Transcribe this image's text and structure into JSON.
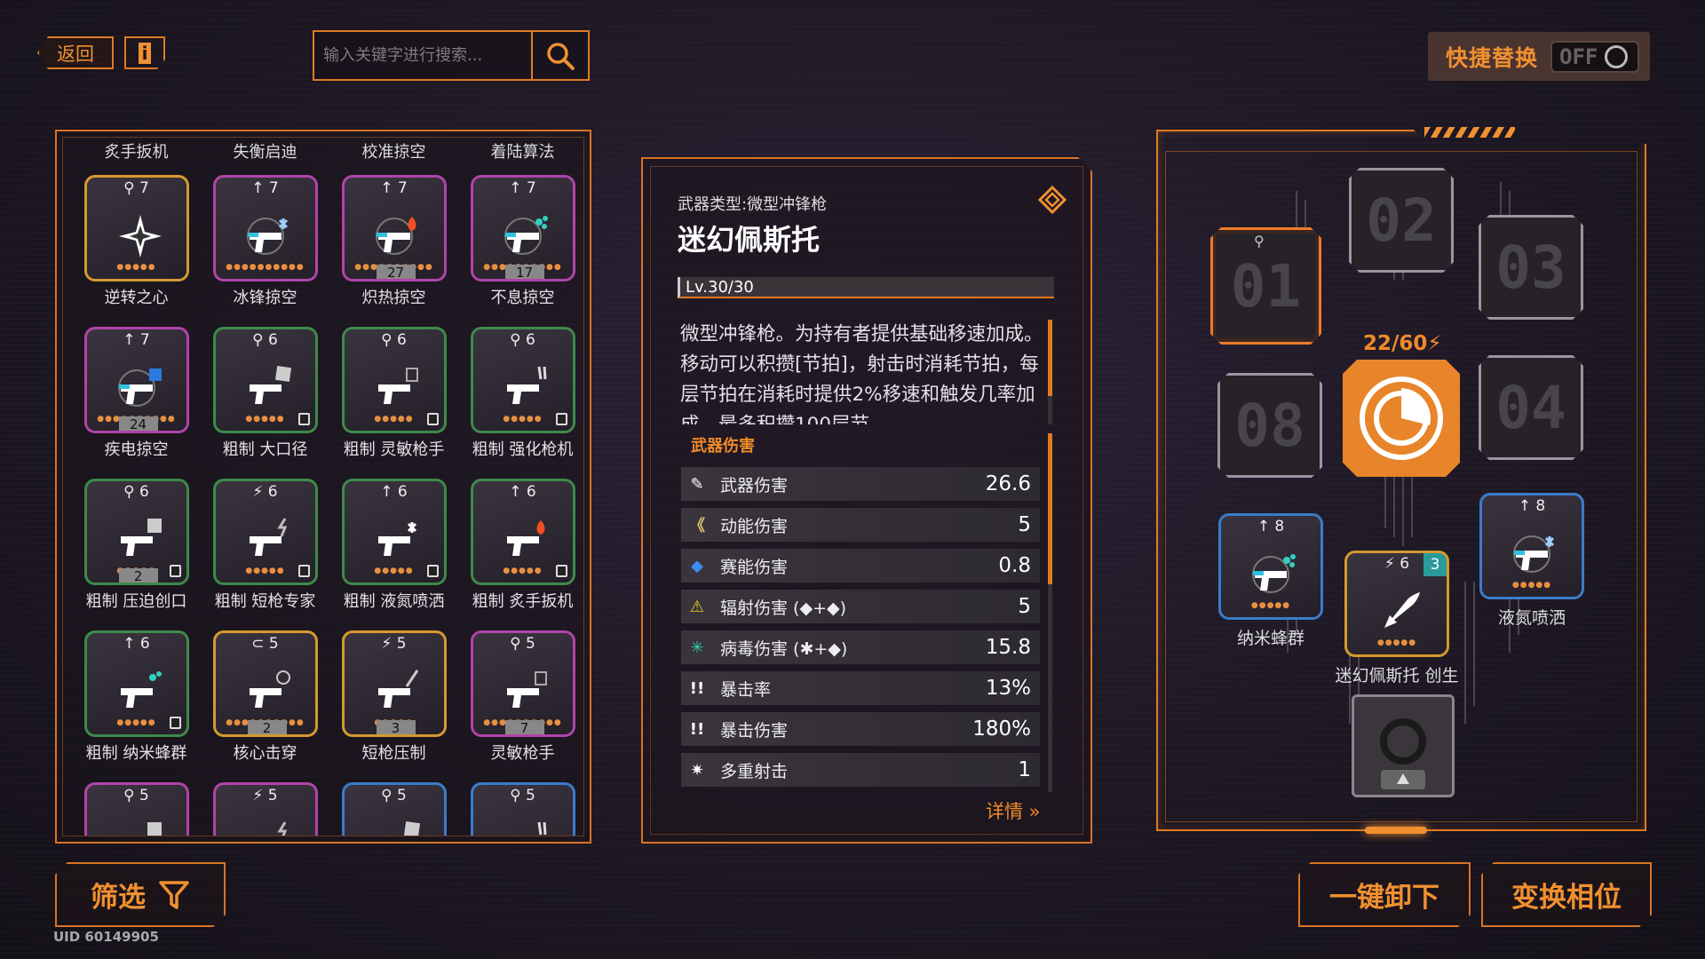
{
  "top": {
    "back_label": "返回",
    "info_label": "i",
    "search_placeholder": "输入关键字进行搜索...",
    "quick_swap_label": "快捷替换",
    "toggle_state": "OFF"
  },
  "inventory": {
    "top_names": [
      "炙手扳机",
      "失衡启迪",
      "校准掠空",
      "着陆算法"
    ],
    "rows": [
      [
        {
          "lv": "⚲ 7",
          "name": "逆转之心",
          "rarity": "gold",
          "icon": "star-core-icon",
          "dots": "●●●●●",
          "num": "",
          "lock": false
        },
        {
          "lv": "↑ 7",
          "name": "冰锋掠空",
          "rarity": "purple",
          "icon": "gun-ice-icon",
          "dots": "●●●●●●●●●●",
          "num": "",
          "lock": false
        },
        {
          "lv": "↑ 7",
          "name": "炽热掠空",
          "rarity": "purple",
          "icon": "gun-fire-icon",
          "dots": "●●●●●●●●●●",
          "num": "27",
          "lock": false
        },
        {
          "lv": "↑ 7",
          "name": "不息掠空",
          "rarity": "purple",
          "icon": "gun-virus-icon",
          "dots": "●●●●●●●●●●",
          "num": "17",
          "lock": false
        }
      ],
      [
        {
          "lv": "↑ 7",
          "name": "疾电掠空",
          "rarity": "purple",
          "icon": "gun-psionic-icon",
          "dots": "●●●●●●●●●●",
          "num": "24",
          "lock": false
        },
        {
          "lv": "⚲ 6",
          "name": "粗制 大口径",
          "rarity": "green",
          "icon": "pistol-damage-icon",
          "dots": "●●●●●",
          "num": "",
          "lock": true
        },
        {
          "lv": "⚲ 6",
          "name": "粗制 灵敏枪手",
          "rarity": "green",
          "icon": "pistol-multishot-icon",
          "dots": "●●●●●",
          "num": "",
          "lock": true
        },
        {
          "lv": "⚲ 6",
          "name": "粗制 强化枪机",
          "rarity": "green",
          "icon": "pistol-crit-icon",
          "dots": "●●●●●",
          "num": "",
          "lock": true
        }
      ],
      [
        {
          "lv": "⚲ 6",
          "name": "粗制 压迫创口",
          "rarity": "green",
          "icon": "pistol-critdmg-icon",
          "dots": "●●●●●",
          "num": "2",
          "lock": true
        },
        {
          "lv": "⚡ 6",
          "name": "粗制 短枪专家",
          "rarity": "green",
          "icon": "pistol-lightning-icon",
          "dots": "●●●●●",
          "num": "",
          "lock": true
        },
        {
          "lv": "↑ 6",
          "name": "粗制 液氮喷洒",
          "rarity": "green",
          "icon": "pistol-ice-icon",
          "dots": "●●●●●",
          "num": "",
          "lock": true
        },
        {
          "lv": "↑ 6",
          "name": "粗制 炙手扳机",
          "rarity": "green",
          "icon": "pistol-fire-icon",
          "dots": "●●●●●",
          "num": "",
          "lock": true
        }
      ],
      [
        {
          "lv": "↑ 6",
          "name": "粗制 纳米蜂群",
          "rarity": "green",
          "icon": "pistol-virus-icon",
          "dots": "●●●●●",
          "num": "",
          "lock": true
        },
        {
          "lv": "⊂ 5",
          "name": "核心击穿",
          "rarity": "gold",
          "icon": "pistol-target-icon",
          "dots": "●●●●●●●●●●",
          "num": "2",
          "lock": false
        },
        {
          "lv": "⚡ 5",
          "name": "短枪压制",
          "rarity": "gold",
          "icon": "pistol-blade-icon",
          "dots": "●●●●●",
          "num": "3",
          "lock": false
        },
        {
          "lv": "⚲ 5",
          "name": "灵敏枪手",
          "rarity": "purple",
          "icon": "pistol-multishot-icon",
          "dots": "●●●●●●●●●●",
          "num": "7",
          "lock": false
        }
      ],
      [
        {
          "lv": "⚲ 5",
          "name": "",
          "rarity": "purple",
          "icon": "pistol-critdmg-icon",
          "dots": "",
          "num": "",
          "lock": false
        },
        {
          "lv": "⚡ 5",
          "name": "",
          "rarity": "purple",
          "icon": "pistol-lightning-icon",
          "dots": "",
          "num": "",
          "lock": false
        },
        {
          "lv": "⚲ 5",
          "name": "",
          "rarity": "blue",
          "icon": "pistol-damage-icon",
          "dots": "",
          "num": "",
          "lock": false
        },
        {
          "lv": "⚲ 5",
          "name": "",
          "rarity": "blue",
          "icon": "pistol-crit-icon",
          "dots": "",
          "num": "",
          "lock": false
        }
      ]
    ]
  },
  "detail": {
    "weapon_type": "武器类型:微型冲锋枪",
    "weapon_name": "迷幻佩斯托",
    "level": "Lv.30/30",
    "description": "微型冲锋枪。为持有者提供基础移速加成。移动可以积攒[节拍]，射击时消耗节拍，每层节拍在消耗时提供2%移速和触发几率加成，最多积攒100层节",
    "section_title": "武器伤害",
    "stats": [
      {
        "label": "武器伤害",
        "value": "26.6",
        "icon": "weapon-damage-icon",
        "glyph": "✎",
        "color": "#ffffff"
      },
      {
        "label": "动能伤害",
        "value": "5",
        "icon": "kinetic-icon",
        "glyph": "《",
        "color": "#d8c070"
      },
      {
        "label": "赛能伤害",
        "value": "0.8",
        "icon": "psionic-icon",
        "glyph": "◆",
        "color": "#3a8ef0"
      },
      {
        "label": "辐射伤害 (◆+◆)",
        "value": "5",
        "icon": "radiation-icon",
        "glyph": "⚠",
        "color": "#f0d020"
      },
      {
        "label": "病毒伤害 (✱+◆)",
        "value": "15.8",
        "icon": "virus-icon",
        "glyph": "✳",
        "color": "#30d0b0"
      },
      {
        "label": "暴击率",
        "value": "13%",
        "icon": "crit-rate-icon",
        "glyph": "!!",
        "color": "#ffffff"
      },
      {
        "label": "暴击伤害",
        "value": "180%",
        "icon": "crit-damage-icon",
        "glyph": "!!",
        "color": "#ffffff"
      },
      {
        "label": "多重射击",
        "value": "1",
        "icon": "multishot-icon",
        "glyph": "✷",
        "color": "#ffffff"
      }
    ],
    "more_label": "详情 »"
  },
  "loadout": {
    "slots": [
      "01",
      "02",
      "03",
      "04",
      "08"
    ],
    "energy": "22/60⚡",
    "equipped": [
      {
        "lv": "↑ 8",
        "name": "纳米蜂群",
        "icon": "gun-virus-icon"
      },
      {
        "lv": "⚡ 6",
        "name": "迷幻佩斯托 创生",
        "icon": "rocket-icon",
        "badge": "3"
      },
      {
        "lv": "↑ 8",
        "name": "液氮喷洒",
        "icon": "gun-ice-icon"
      }
    ]
  },
  "bottom": {
    "filter_label": "筛选",
    "unequip_all_label": "一键卸下",
    "swap_phase_label": "变换相位",
    "uid": "UID 60149905"
  }
}
